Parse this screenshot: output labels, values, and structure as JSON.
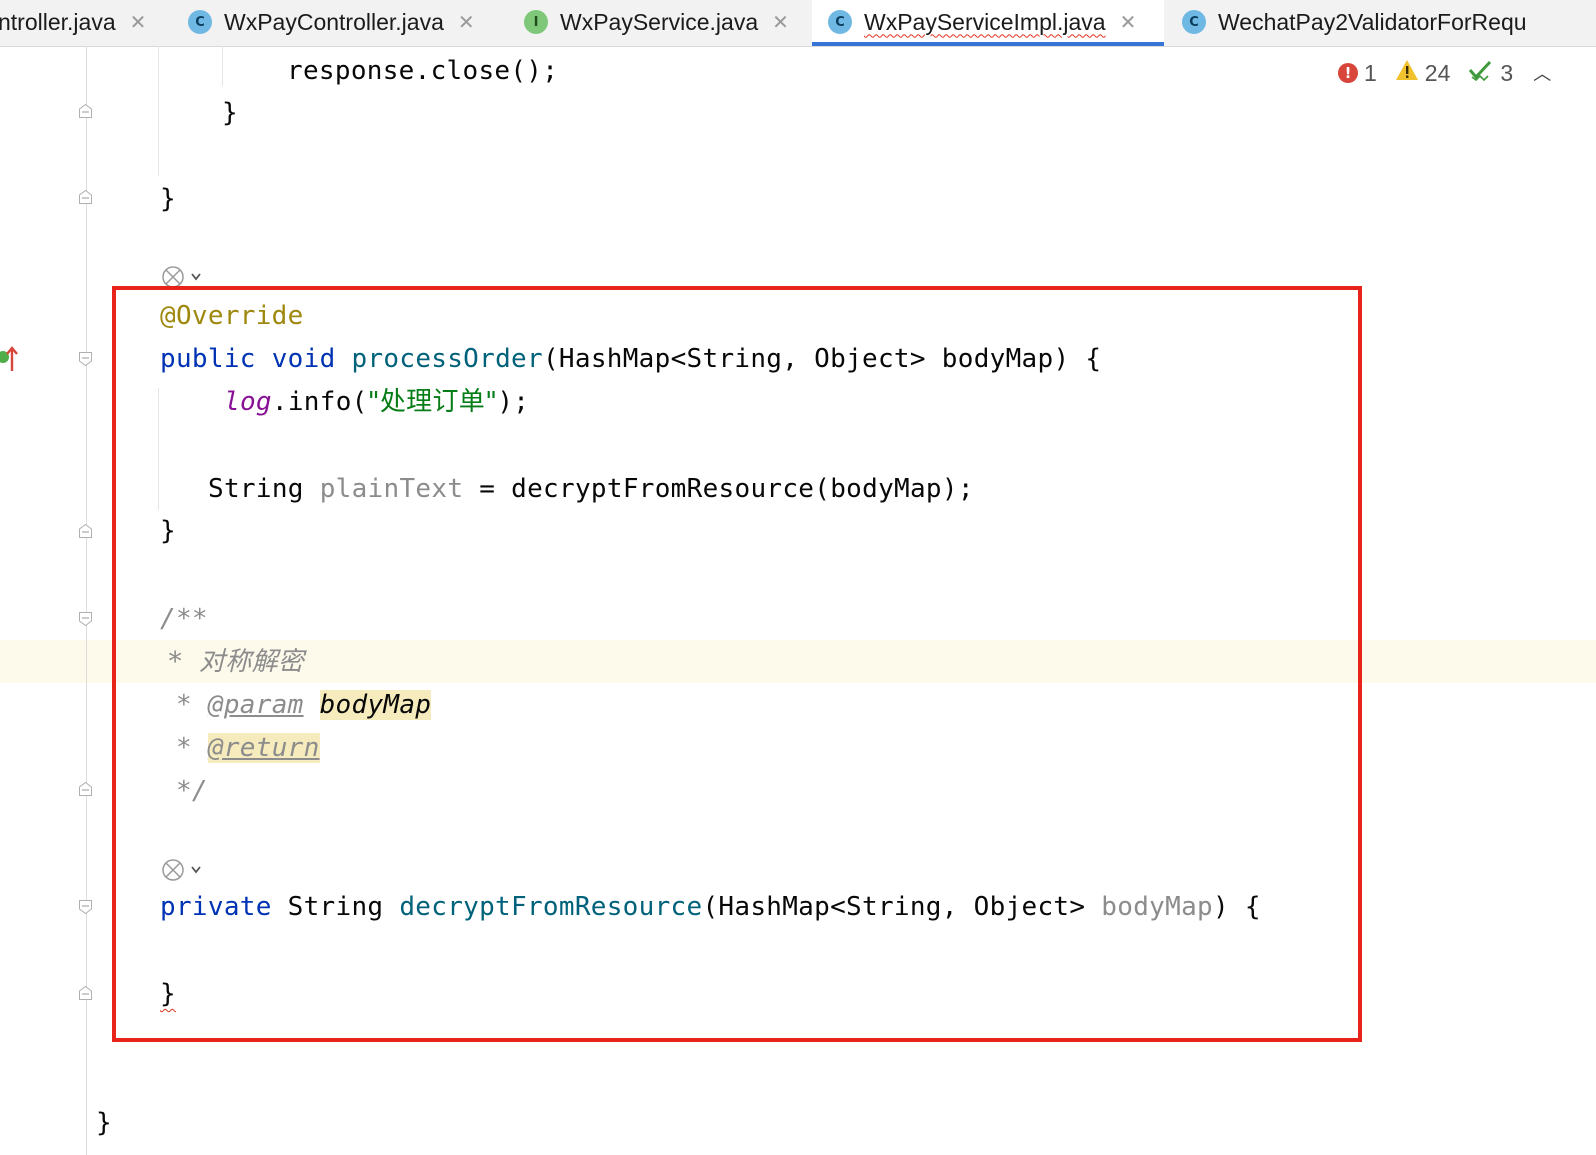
{
  "tabs": [
    {
      "label": "ntroller.java",
      "icon": "",
      "icon_name": "",
      "active": false
    },
    {
      "label": "WxPayController.java",
      "icon": "C",
      "icon_name": "class-icon",
      "active": false
    },
    {
      "label": "WxPayService.java",
      "icon": "I",
      "icon_name": "interface-icon",
      "active": false
    },
    {
      "label": "WxPayServiceImpl.java",
      "icon": "C",
      "icon_name": "class-icon",
      "active": true
    },
    {
      "label": "WechatPay2ValidatorForRequ",
      "icon": "C",
      "icon_name": "class-icon",
      "active": false
    }
  ],
  "inspections": {
    "errors": "1",
    "warnings": "24",
    "ok": "3"
  },
  "code": {
    "l1": "response.close();",
    "l2": "}",
    "l3": "}",
    "l4_annotation": "@Override",
    "l5_public": "public",
    "l5_void": "void",
    "l5_name": "processOrder",
    "l5_params": "(HashMap<String, Object> bodyMap) {",
    "l6_log": "log",
    "l6_call": ".info(",
    "l6_str": "\"处理订单\"",
    "l6_end": ");",
    "l7_type": "String ",
    "l7_var": "plainText",
    "l7_rest": " = decryptFromResource(bodyMap);",
    "l8": "}",
    "l9": "/**",
    "l10": " *  对称解密",
    "l11_star": " * ",
    "l11_tag": "@param",
    "l11_param": "bodyMap",
    "l12_star": " * ",
    "l12_tag": "@return",
    "l13": " */",
    "l14_private": "private",
    "l14_type": " String ",
    "l14_name": "decryptFromResource",
    "l14_params": "(HashMap<String, Object> ",
    "l14_unused": "bodyMap",
    "l14_end": ") {",
    "l15": "}",
    "l16": "}"
  },
  "colors": {
    "keyword": "#0033b3",
    "annotation": "#9e880d",
    "method": "#00627a",
    "string": "#067d17",
    "field": "#871094",
    "comment": "#8c8c8c",
    "highlight_box": "#e8231a",
    "active_tab_underline": "#3874d8"
  }
}
